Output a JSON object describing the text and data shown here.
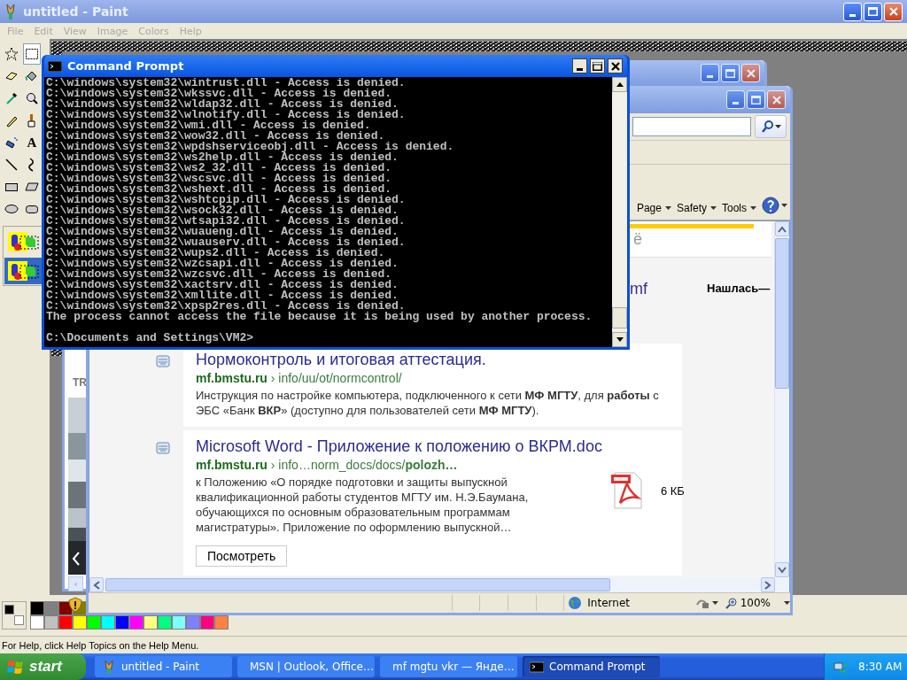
{
  "paint": {
    "title": "untitled - Paint",
    "menu": [
      "File",
      "Edit",
      "View",
      "Image",
      "Colors",
      "Help"
    ],
    "tools": [
      {
        "kind": "free-select",
        "selected": false
      },
      {
        "kind": "select",
        "selected": true
      },
      {
        "kind": "eraser",
        "selected": false
      },
      {
        "kind": "fill",
        "selected": false
      },
      {
        "kind": "picker",
        "selected": false
      },
      {
        "kind": "magnifier",
        "selected": false
      },
      {
        "kind": "pencil",
        "selected": false
      },
      {
        "kind": "brush",
        "selected": false
      },
      {
        "kind": "airbrush",
        "selected": false
      },
      {
        "kind": "text",
        "label": "A",
        "selected": false
      },
      {
        "kind": "line",
        "selected": false
      },
      {
        "kind": "curve",
        "selected": false
      },
      {
        "kind": "rectangle",
        "selected": false
      },
      {
        "kind": "polygon",
        "selected": false
      },
      {
        "kind": "ellipse",
        "selected": false
      },
      {
        "kind": "rounded-rectangle",
        "selected": false
      }
    ],
    "options": [
      {
        "selected": false
      },
      {
        "selected": true
      }
    ],
    "foreground": {
      "color": "#000000"
    },
    "background": {
      "color": "#ffffff"
    },
    "palette_top": [
      {
        "color": "#000000"
      },
      {
        "color": "#808080"
      },
      {
        "color": "#800000"
      },
      {
        "color": "#808000"
      }
    ],
    "palette_bottom": [
      {
        "color": "#ffffff"
      },
      {
        "color": "#c0c0c0"
      },
      {
        "color": "#ff0000"
      },
      {
        "color": "#ffff00"
      },
      {
        "color": "#00ff00"
      },
      {
        "color": "#00ffff"
      },
      {
        "color": "#0000ff"
      },
      {
        "color": "#ff00ff"
      },
      {
        "color": "#ffff80"
      },
      {
        "color": "#00ff80"
      },
      {
        "color": "#80ffff"
      },
      {
        "color": "#8080ff"
      },
      {
        "color": "#ff0080"
      },
      {
        "color": "#ff8040"
      }
    ],
    "status": "For Help, click Help Topics on the Help Menu."
  },
  "ie_back": {
    "side_text": "TR"
  },
  "ie": {
    "command_bar": [
      "Page",
      "Safety",
      "Tools"
    ],
    "tab_fragment": "ё",
    "link_fragment": "mf",
    "found_text": "Нашлась—",
    "results": [
      {
        "kind": "page",
        "title": "Нормоконтроль и итоговая аттестация.",
        "host": "mf.bmstu.ru",
        "path": "› info/uu/ot/normcontrol/",
        "snippet": "Инструкция по настройке компьютера, подключенного к сети **МФ МГТУ**, для **работы** с ЭБС «Банк **ВКР**» (доступно для пользователей сети **МФ МГТУ**)."
      },
      {
        "kind": "pdf",
        "title": "Microsoft Word - Приложение к положению о ВКРМ.doc",
        "host": "mf.bmstu.ru",
        "path": "› info…norm_docs/docs/**polozh…**",
        "snippet": "к Положению «О порядке подготовки и защиты выпускной квалификационной работы студентов МГТУ им. Н.Э.Баумана, обучающихся по основным образовательным программам магистратуры». Приложение по оформлению выпускной…",
        "file_size": "6 КБ",
        "button": "Посмотреть"
      }
    ],
    "status_zone": "Internet",
    "zoom": "100%"
  },
  "cmd": {
    "title": "Command Prompt",
    "lines": [
      "C:\\windows\\system32\\wintrust.dll - Access is denied.",
      "C:\\windows\\system32\\wkssvc.dll - Access is denied.",
      "C:\\windows\\system32\\wldap32.dll - Access is denied.",
      "C:\\windows\\system32\\wlnotify.dll - Access is denied.",
      "C:\\windows\\system32\\wmi.dll - Access is denied.",
      "C:\\windows\\system32\\wow32.dll - Access is denied.",
      "C:\\windows\\system32\\wpdshserviceobj.dll - Access is denied.",
      "C:\\windows\\system32\\ws2help.dll - Access is denied.",
      "C:\\windows\\system32\\ws2_32.dll - Access is denied.",
      "C:\\windows\\system32\\wscsvc.dll - Access is denied.",
      "C:\\windows\\system32\\wshext.dll - Access is denied.",
      "C:\\windows\\system32\\wshtcpip.dll - Access is denied.",
      "C:\\windows\\system32\\wsock32.dll - Access is denied.",
      "C:\\windows\\system32\\wtsapi32.dll - Access is denied.",
      "C:\\windows\\system32\\wuaueng.dll - Access is denied.",
      "C:\\windows\\system32\\wuauserv.dll - Access is denied.",
      "C:\\windows\\system32\\wups2.dll - Access is denied.",
      "C:\\windows\\system32\\wzcsapi.dll - Access is denied.",
      "C:\\windows\\system32\\wzcsvc.dll - Access is denied.",
      "C:\\windows\\system32\\xactsrv.dll - Access is denied.",
      "C:\\windows\\system32\\xmllite.dll - Access is denied.",
      "C:\\windows\\system32\\xpsp2res.dll - Access is denied.",
      "The process cannot access the file because it is being used by another process."
    ],
    "prompt": "C:\\Documents and Settings\\VM2>"
  },
  "taskbar": {
    "start": "start",
    "items": [
      {
        "kind": "paint",
        "label": "untitled - Paint",
        "selected": false
      },
      {
        "kind": "ie",
        "label": "MSN | Outlook, Office…",
        "selected": false
      },
      {
        "kind": "ie",
        "label": "mf mgtu vkr — Янде…",
        "selected": false
      },
      {
        "kind": "cmd",
        "label": "Command Prompt",
        "selected": true
      }
    ],
    "clock": "8:30 AM"
  }
}
